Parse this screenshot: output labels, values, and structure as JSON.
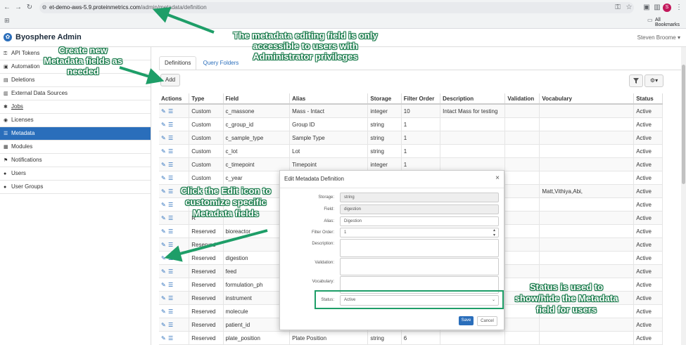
{
  "browser": {
    "url_host": "et-demo-aws-5.9.proteinmetrics.com",
    "url_path": "/admin/metadata/definition",
    "bookmarks_label": "All Bookmarks",
    "profile_initial": "S",
    "icons": [
      "back-icon",
      "forward-icon",
      "reload-icon",
      "site-info-icon",
      "password-key-icon",
      "star-icon",
      "reading-list-icon",
      "profile-icon",
      "menu-icon",
      "apps-icon",
      "bookmarks-folder-icon"
    ]
  },
  "app": {
    "title": "Byosphere Admin",
    "user": "Steven Broome"
  },
  "sidebar": {
    "items": [
      {
        "label": "API Tokens",
        "icon": "key-icon"
      },
      {
        "label": "Automation",
        "icon": "robot-icon"
      },
      {
        "label": "Deletions",
        "icon": "trash-icon"
      },
      {
        "label": "External Data Sources",
        "icon": "database-icon"
      },
      {
        "label": "Jobs",
        "icon": "tasks-icon"
      },
      {
        "label": "Licenses",
        "icon": "certificate-icon"
      },
      {
        "label": "Metadata",
        "icon": "list-icon",
        "active": true
      },
      {
        "label": "Modules",
        "icon": "cubes-icon"
      },
      {
        "label": "Notifications",
        "icon": "flag-icon"
      },
      {
        "label": "Users",
        "icon": "user-icon"
      },
      {
        "label": "User Groups",
        "icon": "users-icon"
      }
    ]
  },
  "tabs": [
    {
      "label": "Definitions",
      "active": true
    },
    {
      "label": "Query Folders",
      "active": false
    }
  ],
  "toolbar": {
    "add_label": "Add"
  },
  "table": {
    "headers": [
      "Actions",
      "Type",
      "Field",
      "Alias",
      "Storage",
      "Filter Order",
      "Description",
      "Validation",
      "Vocabulary",
      "Status"
    ],
    "rows": [
      [
        "",
        "Custom",
        "c_massone",
        "Mass - Intact",
        "integer",
        "10",
        "Intact Mass for testing",
        "",
        "",
        "Active"
      ],
      [
        "",
        "Custom",
        "c_group_id",
        "Group ID",
        "string",
        "1",
        "",
        "",
        "",
        "Active"
      ],
      [
        "",
        "Custom",
        "c_sample_type",
        "Sample Type",
        "string",
        "1",
        "",
        "",
        "",
        "Active"
      ],
      [
        "",
        "Custom",
        "c_lot",
        "Lot",
        "string",
        "1",
        "",
        "",
        "",
        "Active"
      ],
      [
        "",
        "Custom",
        "c_timepoint",
        "Timepoint",
        "integer",
        "1",
        "",
        "",
        "",
        "Active"
      ],
      [
        "",
        "Custom",
        "c_year",
        "",
        "",
        "",
        "",
        "",
        "",
        "Active"
      ],
      [
        "",
        "",
        "",
        "",
        "",
        "",
        "",
        "",
        "Matt,Vithiya,Abi,",
        "Active"
      ],
      [
        "",
        "",
        "",
        "",
        "",
        "",
        "",
        "",
        "",
        "Active"
      ],
      [
        "",
        "R",
        "",
        "",
        "",
        "",
        "",
        "",
        "",
        "Active"
      ],
      [
        "",
        "Reserved",
        "bioreactor",
        "",
        "",
        "",
        "",
        "",
        "",
        "Active"
      ],
      [
        "",
        "Reserved",
        "",
        "",
        "",
        "",
        "",
        "",
        "",
        "Active"
      ],
      [
        "",
        "Reserved",
        "digestion",
        "",
        "",
        "",
        "",
        "",
        "",
        "Active"
      ],
      [
        "",
        "Reserved",
        "feed",
        "",
        "",
        "",
        "",
        "",
        "",
        "Active"
      ],
      [
        "",
        "Reserved",
        "formulation_ph",
        "",
        "",
        "",
        "",
        "",
        "",
        "Active"
      ],
      [
        "",
        "Reserved",
        "instrument",
        "",
        "",
        "",
        "",
        "",
        "",
        "Active"
      ],
      [
        "",
        "Reserved",
        "molecule",
        "",
        "",
        "",
        "",
        "",
        "",
        "Active"
      ],
      [
        "",
        "Reserved",
        "patient_id",
        "",
        "",
        "",
        "",
        "",
        "",
        "Active"
      ],
      [
        "",
        "Reserved",
        "plate_position",
        "Plate Position",
        "string",
        "6",
        "",
        "",
        "",
        "Active"
      ]
    ]
  },
  "modal": {
    "title": "Edit Metadata Definition",
    "close": "×",
    "fields": {
      "storage_label": "Storage:",
      "storage_value": "string",
      "field_label": "Field:",
      "field_value": "digestion",
      "alias_label": "Alias:",
      "alias_value": "Digestion",
      "filter_label": "Filter Order:",
      "filter_value": "1",
      "description_label": "Description:",
      "validation_label": "Validation:",
      "vocabulary_label": "Vocabulary:",
      "status_label": "Status:",
      "status_value": "Active"
    },
    "save_label": "Save",
    "cancel_label": "Cancel"
  },
  "annotations": {
    "top": "The metadata editing field is only accessible to users with Administrator privileges",
    "add": "Create new Metadata fields as needed",
    "edit": "Click the Edit icon to customize specific Metadata fields",
    "status": "Status is used to show/hide the Metadata field for users",
    "color": "#1e9e68"
  }
}
